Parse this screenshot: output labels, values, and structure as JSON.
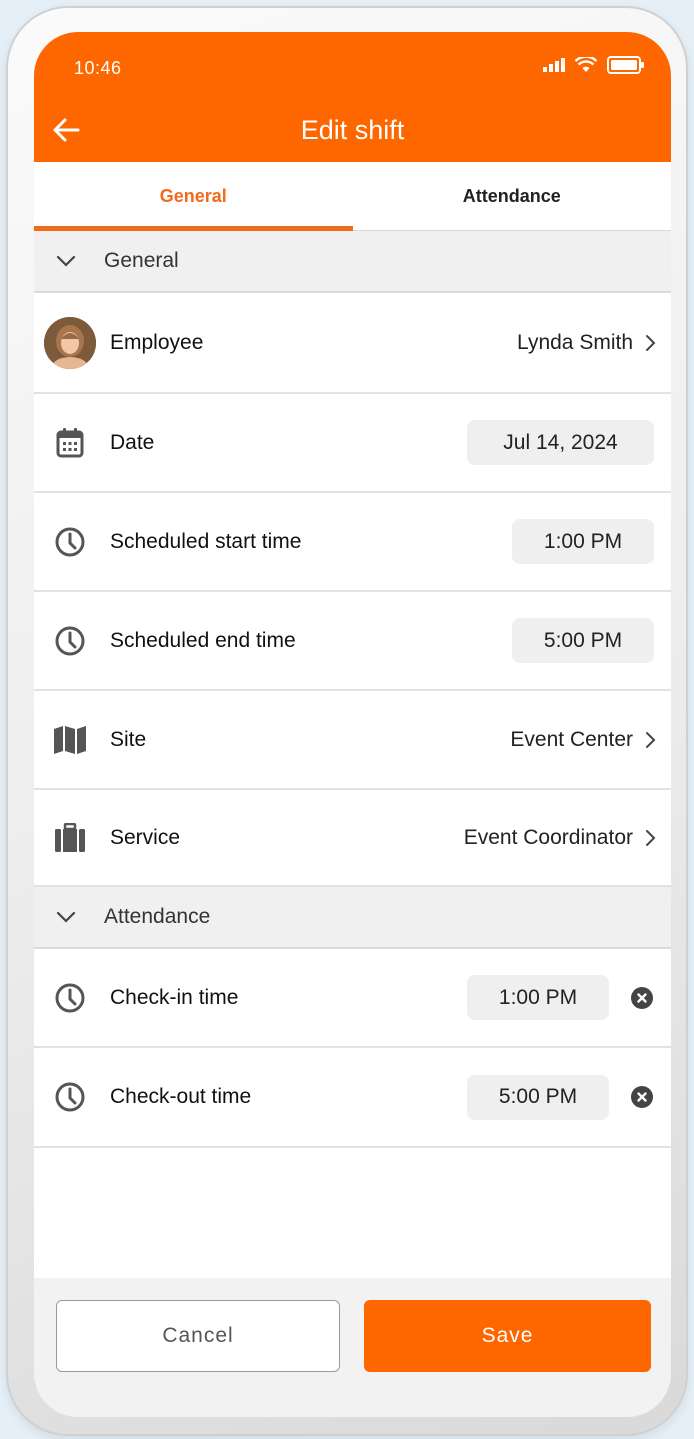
{
  "status_bar": {
    "time": "10:46"
  },
  "header": {
    "title": "Edit shift"
  },
  "tabs": [
    {
      "label": "General"
    },
    {
      "label": "Attendance"
    }
  ],
  "sections": {
    "general": {
      "label": "General"
    },
    "attendance": {
      "label": "Attendance"
    }
  },
  "fields": {
    "employee": {
      "label": "Employee",
      "value": "Lynda Smith"
    },
    "date": {
      "label": "Date",
      "value": "Jul 14, 2024"
    },
    "start": {
      "label": "Scheduled start time",
      "value": "1:00 PM"
    },
    "end": {
      "label": "Scheduled end time",
      "value": "5:00 PM"
    },
    "site": {
      "label": "Site",
      "value": "Event Center"
    },
    "service": {
      "label": "Service",
      "value": "Event Coordinator"
    },
    "checkin": {
      "label": "Check-in time",
      "value": "1:00 PM"
    },
    "checkout": {
      "label": "Check-out time",
      "value": "5:00 PM"
    }
  },
  "buttons": {
    "cancel": "Cancel",
    "save": "Save"
  },
  "icons": [
    "back-arrow-icon",
    "signal-icon",
    "wifi-icon",
    "battery-icon",
    "chevron-down-icon",
    "chevron-right-icon",
    "calendar-icon",
    "clock-icon",
    "map-icon",
    "briefcase-icon",
    "close-circle-icon"
  ],
  "colors": {
    "accent": "#fe6600",
    "tab_active": "#f26a1b"
  }
}
